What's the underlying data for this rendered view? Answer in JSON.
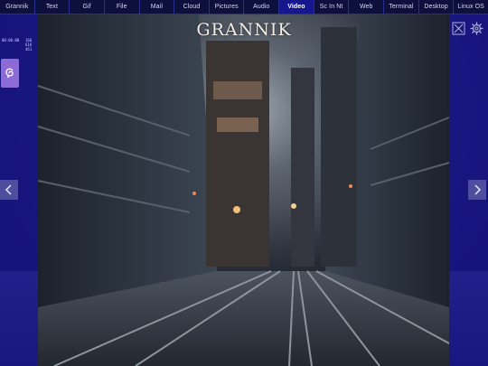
{
  "tabs": [
    {
      "label": "Grannik",
      "active": false
    },
    {
      "label": "Text",
      "active": false
    },
    {
      "label": "Gif",
      "active": false
    },
    {
      "label": "File",
      "active": false
    },
    {
      "label": "Mail",
      "active": false
    },
    {
      "label": "Cloud",
      "active": false
    },
    {
      "label": "Pictures",
      "active": false
    },
    {
      "label": "Audio",
      "active": false
    },
    {
      "label": "Video",
      "active": true
    },
    {
      "label": "Sc In Nt",
      "active": false
    },
    {
      "label": "Web",
      "active": false
    },
    {
      "label": "Terminal",
      "active": false
    },
    {
      "label": "Desktop",
      "active": false
    },
    {
      "label": "Linux OS",
      "active": false
    }
  ],
  "title": "GRANNIK",
  "clock": "00:00:00",
  "stats": [
    "166",
    "616",
    "461"
  ],
  "icons": {
    "app": "swirl-icon",
    "close": "close-box-icon",
    "settings": "gear-icon",
    "prev": "chevron-left-icon",
    "next": "chevron-right-icon"
  },
  "colors": {
    "panel": "#16129a",
    "topbar": "#0d0f3d",
    "active_tab": "#16168f",
    "app_icon": "#8d6bd6"
  }
}
